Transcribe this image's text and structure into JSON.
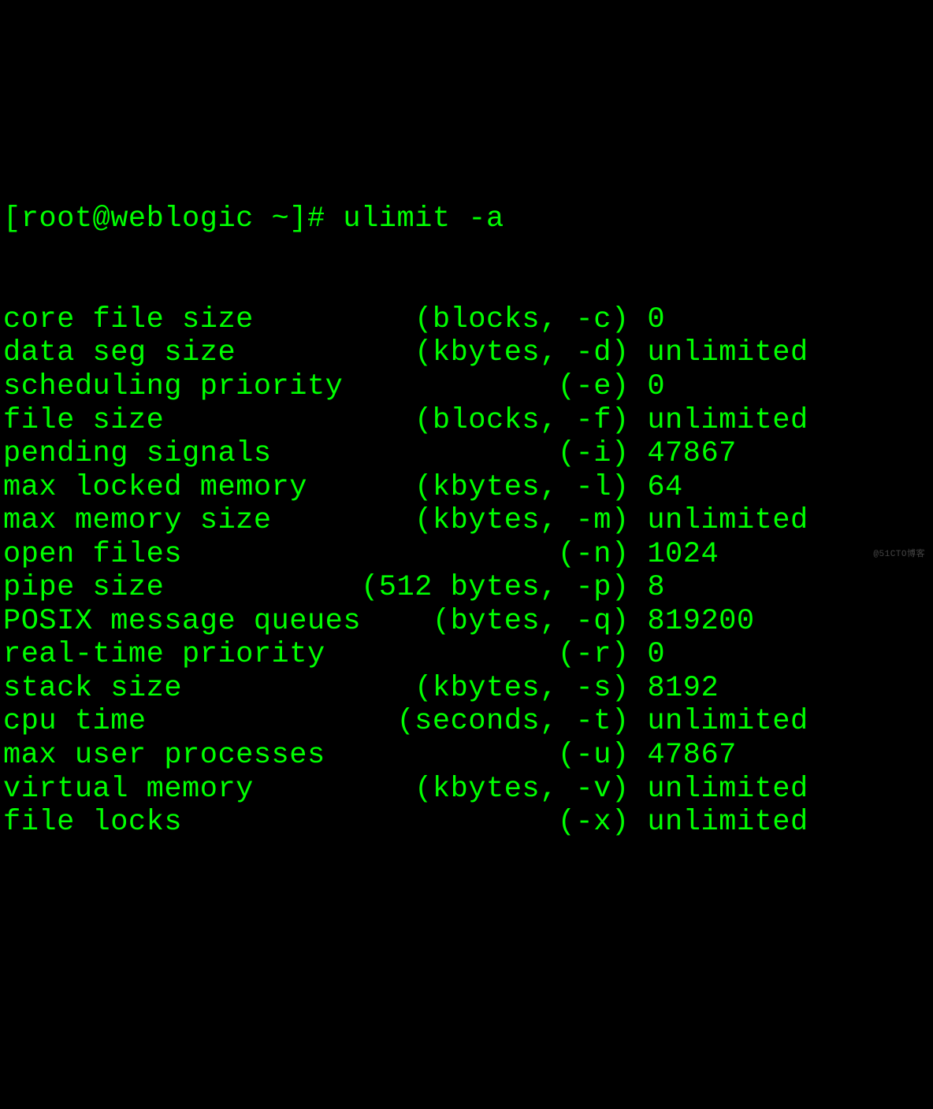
{
  "prompt": "[root@weblogic ~]# ulimit -a",
  "limits": [
    {
      "name": "core file size",
      "unit": "(blocks, -c)",
      "value": "0"
    },
    {
      "name": "data seg size",
      "unit": "(kbytes, -d)",
      "value": "unlimited"
    },
    {
      "name": "scheduling priority",
      "unit": "(-e)",
      "value": "0"
    },
    {
      "name": "file size",
      "unit": "(blocks, -f)",
      "value": "unlimited"
    },
    {
      "name": "pending signals",
      "unit": "(-i)",
      "value": "47867"
    },
    {
      "name": "max locked memory",
      "unit": "(kbytes, -l)",
      "value": "64"
    },
    {
      "name": "max memory size",
      "unit": "(kbytes, -m)",
      "value": "unlimited"
    },
    {
      "name": "open files",
      "unit": "(-n)",
      "value": "1024"
    },
    {
      "name": "pipe size",
      "unit": "(512 bytes, -p)",
      "value": "8"
    },
    {
      "name": "POSIX message queues",
      "unit": "(bytes, -q)",
      "value": "819200"
    },
    {
      "name": "real-time priority",
      "unit": "(-r)",
      "value": "0"
    },
    {
      "name": "stack size",
      "unit": "(kbytes, -s)",
      "value": "8192"
    },
    {
      "name": "cpu time",
      "unit": "(seconds, -t)",
      "value": "unlimited"
    },
    {
      "name": "max user processes",
      "unit": "(-u)",
      "value": "47867"
    },
    {
      "name": "virtual memory",
      "unit": "(kbytes, -v)",
      "value": "unlimited"
    },
    {
      "name": "file locks",
      "unit": "(-x)",
      "value": "unlimited"
    }
  ],
  "name_col_width": 20,
  "unit_col_width": 15,
  "watermark": "@51CTO博客"
}
